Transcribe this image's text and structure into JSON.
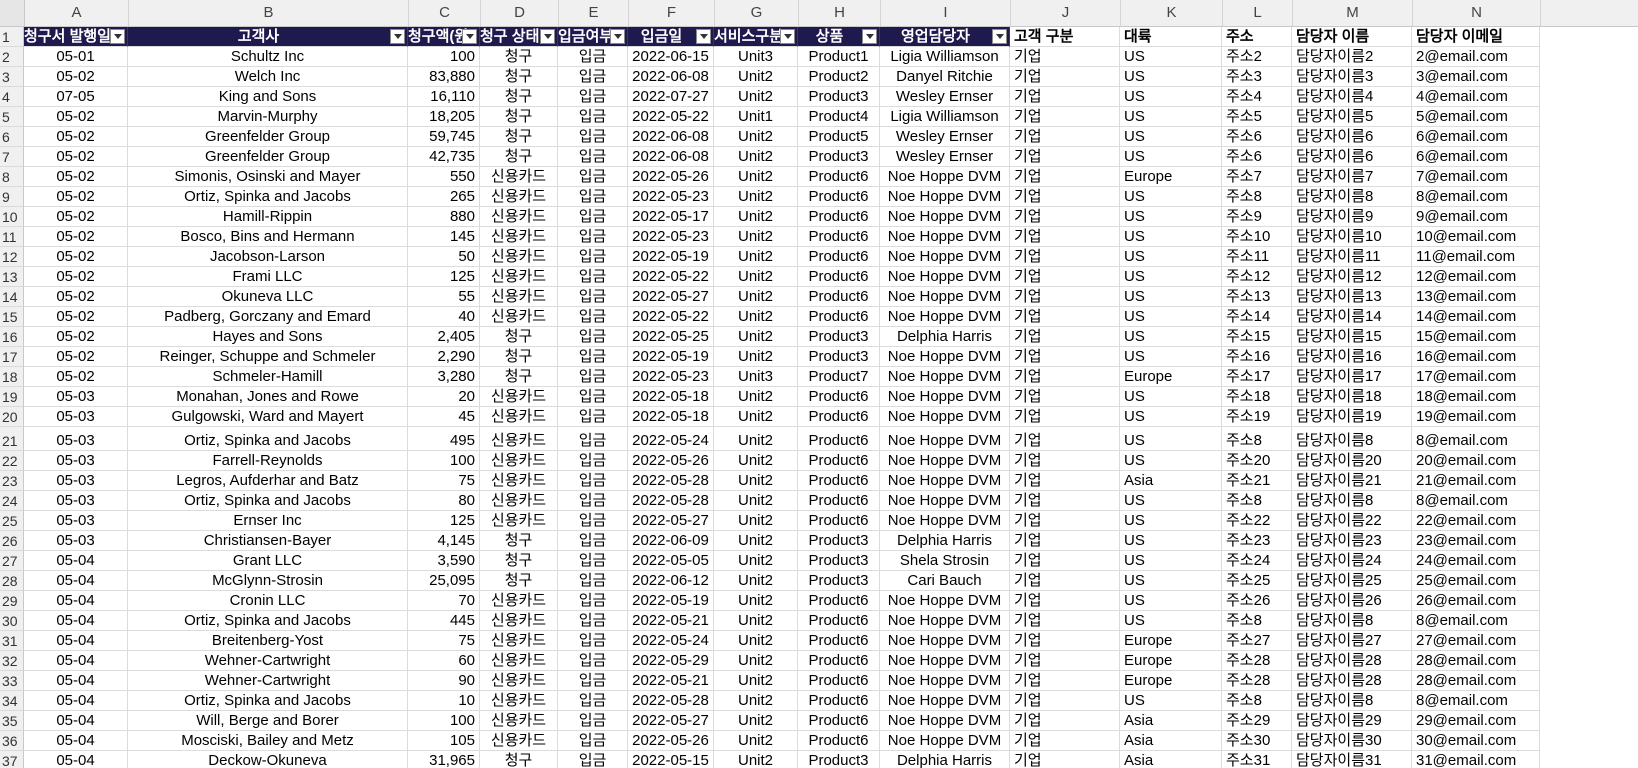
{
  "columns": [
    "A",
    "B",
    "C",
    "D",
    "E",
    "F",
    "G",
    "H",
    "I",
    "J",
    "K",
    "L",
    "M",
    "N"
  ],
  "header_row": {
    "number": "1",
    "labels": [
      "청구서 발행일",
      "고객사",
      "청구액(원)",
      "청구 상태",
      "입금여부",
      "입금일",
      "서비스구분",
      "상품",
      "영업담당자",
      "고객 구분",
      "대륙",
      "주소",
      "담당자 이름",
      "담당자 이메일"
    ]
  },
  "rows": [
    {
      "n": "2",
      "cells": [
        "05-01",
        "Schultz Inc",
        "100",
        "청구",
        "입금",
        "2022-06-15",
        "Unit3",
        "Product1",
        "Ligia Williamson",
        "기업",
        "US",
        "주소2",
        "담당자이름2",
        "2@email.com"
      ]
    },
    {
      "n": "3",
      "cells": [
        "05-02",
        "Welch Inc",
        "83,880",
        "청구",
        "입금",
        "2022-06-08",
        "Unit2",
        "Product2",
        "Danyel Ritchie",
        "기업",
        "US",
        "주소3",
        "담당자이름3",
        "3@email.com"
      ]
    },
    {
      "n": "4",
      "cells": [
        "07-05",
        "King and Sons",
        "16,110",
        "청구",
        "입금",
        "2022-07-27",
        "Unit2",
        "Product3",
        "Wesley Ernser",
        "기업",
        "US",
        "주소4",
        "담당자이름4",
        "4@email.com"
      ]
    },
    {
      "n": "5",
      "cells": [
        "05-02",
        "Marvin-Murphy",
        "18,205",
        "청구",
        "입금",
        "2022-05-22",
        "Unit1",
        "Product4",
        "Ligia Williamson",
        "기업",
        "US",
        "주소5",
        "담당자이름5",
        "5@email.com"
      ]
    },
    {
      "n": "6",
      "cells": [
        "05-02",
        "Greenfelder Group",
        "59,745",
        "청구",
        "입금",
        "2022-06-08",
        "Unit2",
        "Product5",
        "Wesley Ernser",
        "기업",
        "US",
        "주소6",
        "담당자이름6",
        "6@email.com"
      ]
    },
    {
      "n": "7",
      "cells": [
        "05-02",
        "Greenfelder Group",
        "42,735",
        "청구",
        "입금",
        "2022-06-08",
        "Unit2",
        "Product3",
        "Wesley Ernser",
        "기업",
        "US",
        "주소6",
        "담당자이름6",
        "6@email.com"
      ]
    },
    {
      "n": "8",
      "cells": [
        "05-02",
        "Simonis, Osinski and Mayer",
        "550",
        "신용카드",
        "입금",
        "2022-05-26",
        "Unit2",
        "Product6",
        "Noe Hoppe DVM",
        "기업",
        "Europe",
        "주소7",
        "담당자이름7",
        "7@email.com"
      ]
    },
    {
      "n": "9",
      "cells": [
        "05-02",
        "Ortiz, Spinka and Jacobs",
        "265",
        "신용카드",
        "입금",
        "2022-05-23",
        "Unit2",
        "Product6",
        "Noe Hoppe DVM",
        "기업",
        "US",
        "주소8",
        "담당자이름8",
        "8@email.com"
      ]
    },
    {
      "n": "10",
      "cells": [
        "05-02",
        "Hamill-Rippin",
        "880",
        "신용카드",
        "입금",
        "2022-05-17",
        "Unit2",
        "Product6",
        "Noe Hoppe DVM",
        "기업",
        "US",
        "주소9",
        "담당자이름9",
        "9@email.com"
      ]
    },
    {
      "n": "11",
      "cells": [
        "05-02",
        "Bosco, Bins and Hermann",
        "145",
        "신용카드",
        "입금",
        "2022-05-23",
        "Unit2",
        "Product6",
        "Noe Hoppe DVM",
        "기업",
        "US",
        "주소10",
        "담당자이름10",
        "10@email.com"
      ]
    },
    {
      "n": "12",
      "cells": [
        "05-02",
        "Jacobson-Larson",
        "50",
        "신용카드",
        "입금",
        "2022-05-19",
        "Unit2",
        "Product6",
        "Noe Hoppe DVM",
        "기업",
        "US",
        "주소11",
        "담당자이름11",
        "11@email.com"
      ]
    },
    {
      "n": "13",
      "cells": [
        "05-02",
        "Frami LLC",
        "125",
        "신용카드",
        "입금",
        "2022-05-22",
        "Unit2",
        "Product6",
        "Noe Hoppe DVM",
        "기업",
        "US",
        "주소12",
        "담당자이름12",
        "12@email.com"
      ]
    },
    {
      "n": "14",
      "cells": [
        "05-02",
        "Okuneva LLC",
        "55",
        "신용카드",
        "입금",
        "2022-05-27",
        "Unit2",
        "Product6",
        "Noe Hoppe DVM",
        "기업",
        "US",
        "주소13",
        "담당자이름13",
        "13@email.com"
      ]
    },
    {
      "n": "15",
      "cells": [
        "05-02",
        "Padberg, Gorczany and Emard",
        "40",
        "신용카드",
        "입금",
        "2022-05-22",
        "Unit2",
        "Product6",
        "Noe Hoppe DVM",
        "기업",
        "US",
        "주소14",
        "담당자이름14",
        "14@email.com"
      ]
    },
    {
      "n": "16",
      "cells": [
        "05-02",
        "Hayes and Sons",
        "2,405",
        "청구",
        "입금",
        "2022-05-25",
        "Unit2",
        "Product3",
        "Delphia Harris",
        "기업",
        "US",
        "주소15",
        "담당자이름15",
        "15@email.com"
      ]
    },
    {
      "n": "17",
      "cells": [
        "05-02",
        "Reinger, Schuppe and Schmeler",
        "2,290",
        "청구",
        "입금",
        "2022-05-19",
        "Unit2",
        "Product3",
        "Noe Hoppe DVM",
        "기업",
        "US",
        "주소16",
        "담당자이름16",
        "16@email.com"
      ]
    },
    {
      "n": "18",
      "cells": [
        "05-02",
        "Schmeler-Hamill",
        "3,280",
        "청구",
        "입금",
        "2022-05-23",
        "Unit3",
        "Product7",
        "Noe Hoppe DVM",
        "기업",
        "Europe",
        "주소17",
        "담당자이름17",
        "17@email.com"
      ]
    },
    {
      "n": "19",
      "cells": [
        "05-03",
        "Monahan, Jones and Rowe",
        "20",
        "신용카드",
        "입금",
        "2022-05-18",
        "Unit2",
        "Product6",
        "Noe Hoppe DVM",
        "기업",
        "US",
        "주소18",
        "담당자이름18",
        "18@email.com"
      ]
    },
    {
      "n": "20",
      "cells": [
        "05-03",
        "Gulgowski, Ward and Mayert",
        "45",
        "신용카드",
        "입금",
        "2022-05-18",
        "Unit2",
        "Product6",
        "Noe Hoppe DVM",
        "기업",
        "US",
        "주소19",
        "담당자이름19",
        "19@email.com"
      ]
    },
    {
      "n": "21",
      "cells": [
        "05-03",
        "Ortiz, Spinka and Jacobs",
        "495",
        "신용카드",
        "입금",
        "2022-05-24",
        "Unit2",
        "Product6",
        "Noe Hoppe DVM",
        "기업",
        "US",
        "주소8",
        "담당자이름8",
        "8@email.com"
      ]
    },
    {
      "n": "22",
      "cells": [
        "05-03",
        "Farrell-Reynolds",
        "100",
        "신용카드",
        "입금",
        "2022-05-26",
        "Unit2",
        "Product6",
        "Noe Hoppe DVM",
        "기업",
        "US",
        "주소20",
        "담당자이름20",
        "20@email.com"
      ]
    },
    {
      "n": "23",
      "cells": [
        "05-03",
        "Legros, Aufderhar and Batz",
        "75",
        "신용카드",
        "입금",
        "2022-05-28",
        "Unit2",
        "Product6",
        "Noe Hoppe DVM",
        "기업",
        "Asia",
        "주소21",
        "담당자이름21",
        "21@email.com"
      ]
    },
    {
      "n": "24",
      "cells": [
        "05-03",
        "Ortiz, Spinka and Jacobs",
        "80",
        "신용카드",
        "입금",
        "2022-05-28",
        "Unit2",
        "Product6",
        "Noe Hoppe DVM",
        "기업",
        "US",
        "주소8",
        "담당자이름8",
        "8@email.com"
      ]
    },
    {
      "n": "25",
      "cells": [
        "05-03",
        "Ernser Inc",
        "125",
        "신용카드",
        "입금",
        "2022-05-27",
        "Unit2",
        "Product6",
        "Noe Hoppe DVM",
        "기업",
        "US",
        "주소22",
        "담당자이름22",
        "22@email.com"
      ]
    },
    {
      "n": "26",
      "cells": [
        "05-03",
        "Christiansen-Bayer",
        "4,145",
        "청구",
        "입금",
        "2022-06-09",
        "Unit2",
        "Product3",
        "Delphia Harris",
        "기업",
        "US",
        "주소23",
        "담당자이름23",
        "23@email.com"
      ]
    },
    {
      "n": "27",
      "cells": [
        "05-04",
        "Grant LLC",
        "3,590",
        "청구",
        "입금",
        "2022-05-05",
        "Unit2",
        "Product3",
        "Shela Strosin",
        "기업",
        "US",
        "주소24",
        "담당자이름24",
        "24@email.com"
      ]
    },
    {
      "n": "28",
      "cells": [
        "05-04",
        "McGlynn-Strosin",
        "25,095",
        "청구",
        "입금",
        "2022-06-12",
        "Unit2",
        "Product3",
        "Cari Bauch",
        "기업",
        "US",
        "주소25",
        "담당자이름25",
        "25@email.com"
      ]
    },
    {
      "n": "29",
      "cells": [
        "05-04",
        "Cronin LLC",
        "70",
        "신용카드",
        "입금",
        "2022-05-19",
        "Unit2",
        "Product6",
        "Noe Hoppe DVM",
        "기업",
        "US",
        "주소26",
        "담당자이름26",
        "26@email.com"
      ]
    },
    {
      "n": "30",
      "cells": [
        "05-04",
        "Ortiz, Spinka and Jacobs",
        "445",
        "신용카드",
        "입금",
        "2022-05-21",
        "Unit2",
        "Product6",
        "Noe Hoppe DVM",
        "기업",
        "US",
        "주소8",
        "담당자이름8",
        "8@email.com"
      ]
    },
    {
      "n": "31",
      "cells": [
        "05-04",
        "Breitenberg-Yost",
        "75",
        "신용카드",
        "입금",
        "2022-05-24",
        "Unit2",
        "Product6",
        "Noe Hoppe DVM",
        "기업",
        "Europe",
        "주소27",
        "담당자이름27",
        "27@email.com"
      ]
    },
    {
      "n": "32",
      "cells": [
        "05-04",
        "Wehner-Cartwright",
        "60",
        "신용카드",
        "입금",
        "2022-05-29",
        "Unit2",
        "Product6",
        "Noe Hoppe DVM",
        "기업",
        "Europe",
        "주소28",
        "담당자이름28",
        "28@email.com"
      ]
    },
    {
      "n": "33",
      "cells": [
        "05-04",
        "Wehner-Cartwright",
        "90",
        "신용카드",
        "입금",
        "2022-05-21",
        "Unit2",
        "Product6",
        "Noe Hoppe DVM",
        "기업",
        "Europe",
        "주소28",
        "담당자이름28",
        "28@email.com"
      ]
    },
    {
      "n": "34",
      "cells": [
        "05-04",
        "Ortiz, Spinka and Jacobs",
        "10",
        "신용카드",
        "입금",
        "2022-05-28",
        "Unit2",
        "Product6",
        "Noe Hoppe DVM",
        "기업",
        "US",
        "주소8",
        "담당자이름8",
        "8@email.com"
      ]
    },
    {
      "n": "35",
      "cells": [
        "05-04",
        "Will, Berge and Borer",
        "100",
        "신용카드",
        "입금",
        "2022-05-27",
        "Unit2",
        "Product6",
        "Noe Hoppe DVM",
        "기업",
        "Asia",
        "주소29",
        "담당자이름29",
        "29@email.com"
      ]
    },
    {
      "n": "36",
      "cells": [
        "05-04",
        "Mosciski, Bailey and Metz",
        "105",
        "신용카드",
        "입금",
        "2022-05-26",
        "Unit2",
        "Product6",
        "Noe Hoppe DVM",
        "기업",
        "Asia",
        "주소30",
        "담당자이름30",
        "30@email.com"
      ]
    },
    {
      "n": "37",
      "cells": [
        "05-04",
        "Deckow-Okuneva",
        "31,965",
        "청구",
        "입금",
        "2022-05-15",
        "Unit2",
        "Product3",
        "Delphia Harris",
        "기업",
        "Asia",
        "주소31",
        "담당자이름31",
        "31@email.com"
      ]
    }
  ],
  "colors": {
    "header_bg": "#1f1a4d",
    "header_text": "#ffffff",
    "grid": "#dcdcdc",
    "chrome": "#f0f0f0"
  },
  "icons": {
    "filter": "filter-dropdown-icon"
  }
}
